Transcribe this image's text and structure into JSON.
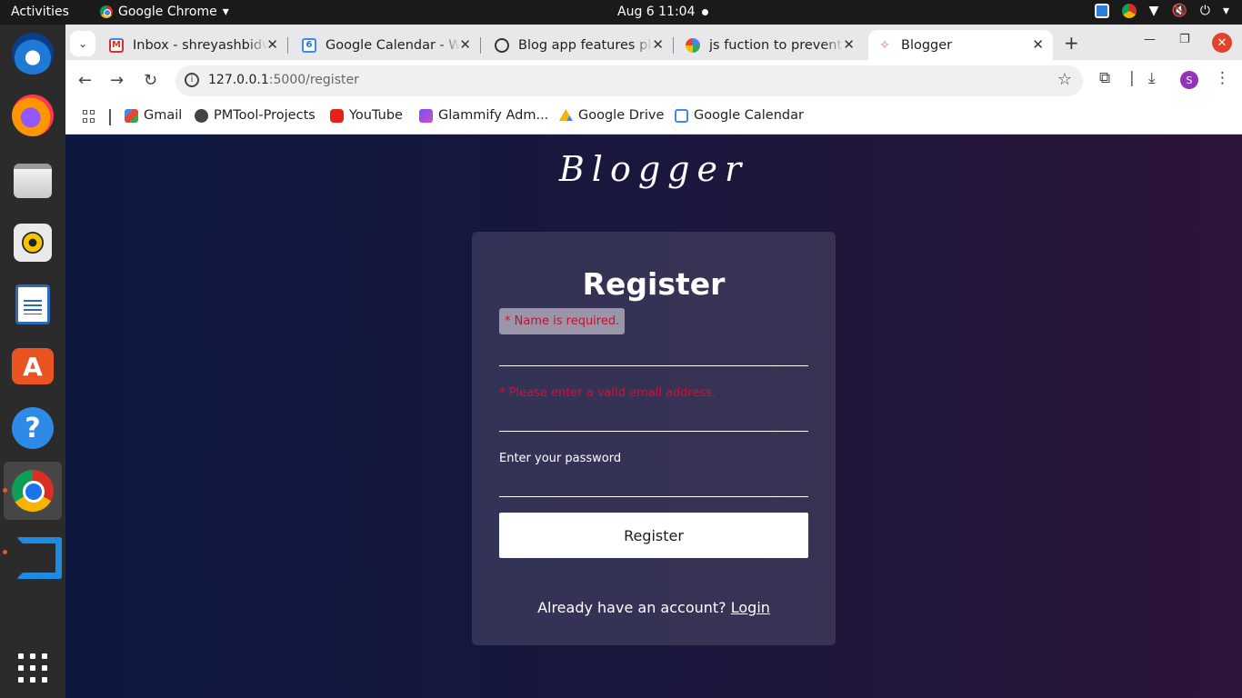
{
  "topbar": {
    "activities": "Activities",
    "app_name": "Google Chrome",
    "clock": "Aug 6  11:04"
  },
  "dock": {
    "items": [
      "thunderbird-icon",
      "firefox-icon",
      "files-icon",
      "rhythmbox-icon",
      "libreoffice-writer-icon",
      "app-center-icon",
      "help-icon",
      "chrome-icon",
      "vscode-icon",
      "show-apps-icon"
    ],
    "running_indicator_color": "#e95420"
  },
  "browser": {
    "tabs": [
      {
        "title": "Inbox - shreyashbidwai",
        "icon": "gmail-icon"
      },
      {
        "title": "Google Calendar - Week",
        "icon": "calendar-icon"
      },
      {
        "title": "Blog app features pl",
        "icon": "chatgpt-icon"
      },
      {
        "title": "js fuction to prevent",
        "icon": "google-icon"
      },
      {
        "title": "Blogger",
        "icon": "blogger-icon",
        "active": true
      }
    ],
    "url_host": "127.0.0.1",
    "url_path": ":5000/register",
    "profile_initial": "S",
    "bookmarks": [
      {
        "label": "Gmail"
      },
      {
        "label": "PMTool-Projects"
      },
      {
        "label": "YouTube"
      },
      {
        "label": "Glammify Adm..."
      },
      {
        "label": "Google Drive"
      },
      {
        "label": "Google Calendar"
      }
    ]
  },
  "page": {
    "brand": "Blogger",
    "form": {
      "title": "Register",
      "name_error": "* Name is required.",
      "email_error": "* Please enter a valid email address.",
      "password_label": "Enter your password",
      "submit_label": "Register",
      "login_prompt": "Already have an account?",
      "login_link": "Login"
    },
    "colors": {
      "background_left": "#0c1840",
      "background_right": "#2c1538",
      "error_text": "#c8102e"
    }
  }
}
